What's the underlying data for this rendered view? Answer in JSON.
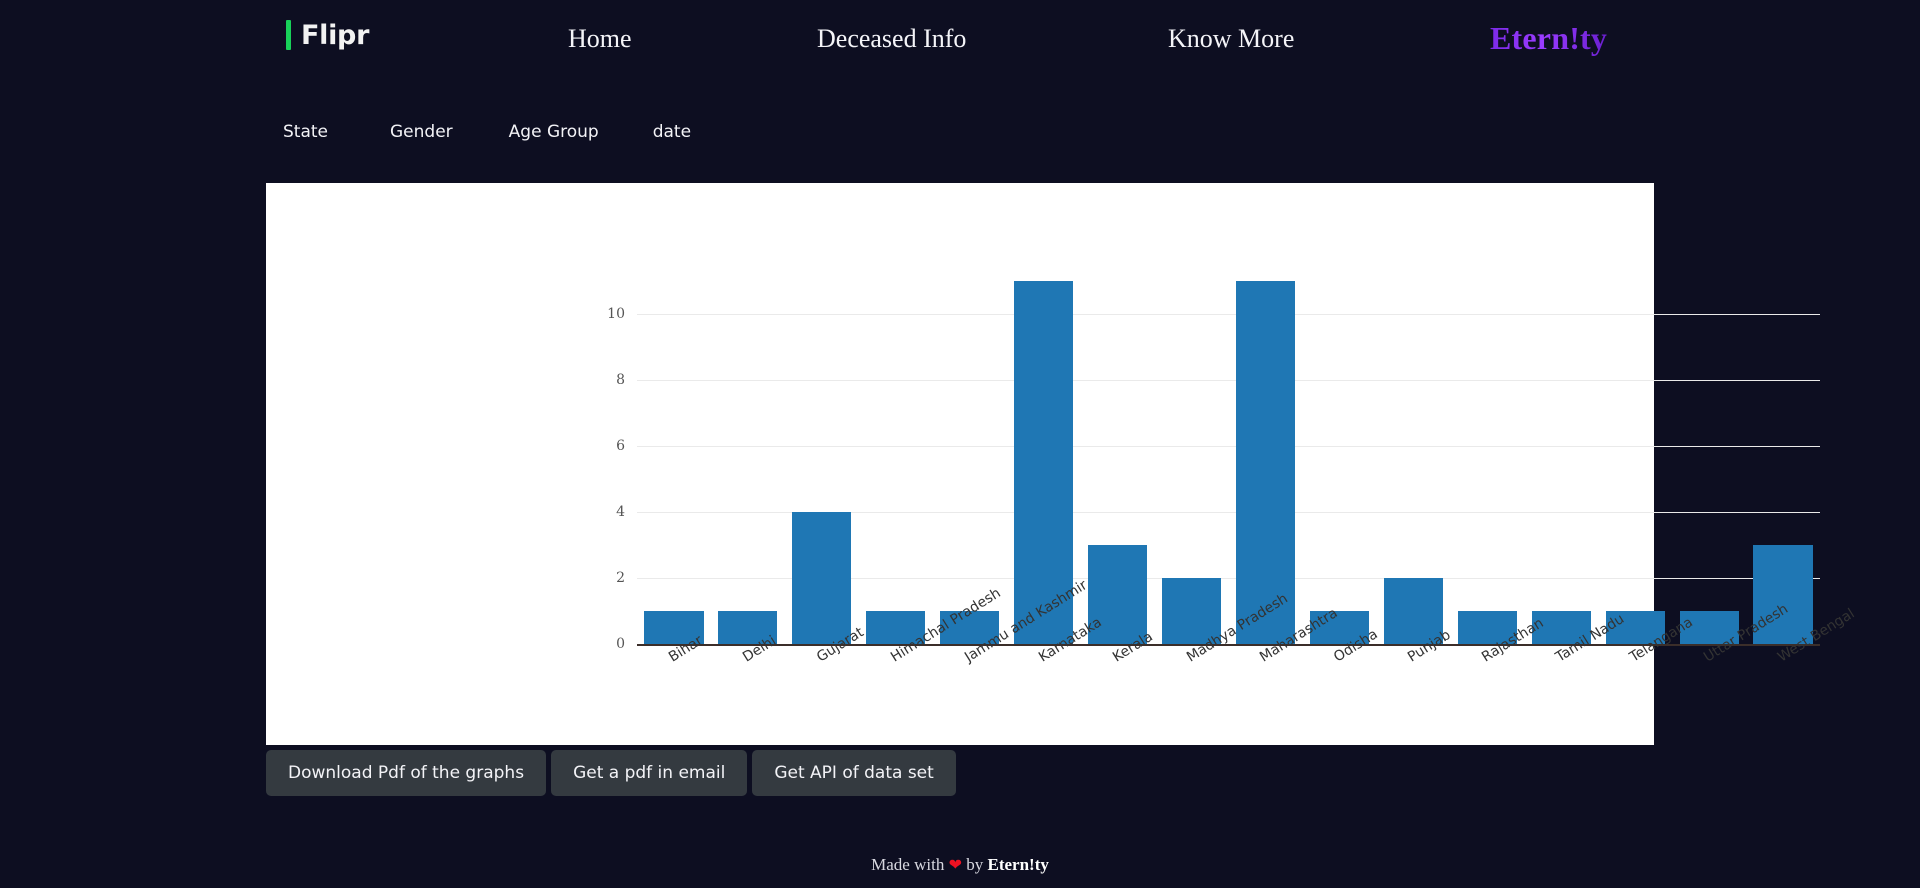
{
  "navbar": {
    "brand": "Flipr",
    "brand_bar_color": "#18d159",
    "links": [
      {
        "label": "Home",
        "name": "nav-link-home"
      },
      {
        "label": "Deceased Info",
        "name": "nav-link-deceased-info"
      },
      {
        "label": "Know More",
        "name": "nav-link-know-more"
      }
    ],
    "logo": "Etern!ty",
    "logo_color": "#8b2ff0"
  },
  "filters": [
    {
      "label": "State"
    },
    {
      "label": "Gender"
    },
    {
      "label": "Age Group"
    },
    {
      "label": "date"
    }
  ],
  "buttons": [
    {
      "label": "Download Pdf of the graphs"
    },
    {
      "label": "Get a pdf in email"
    },
    {
      "label": "Get API of data set"
    }
  ],
  "footer": {
    "prefix": "Made with",
    "heart": "❤",
    "middle": "by",
    "brand": "Etern!ty"
  },
  "theme": {
    "background": "#0d0e21",
    "panel": "#ffffff",
    "bar": "#1f77b4",
    "button": "#343a40",
    "axis": "#3b2e2a",
    "grid": "#eaeaea"
  },
  "chart_data": {
    "type": "bar",
    "title": "",
    "xlabel": "",
    "ylabel": "",
    "ylim": [
      0,
      12
    ],
    "yticks": [
      0,
      2,
      4,
      6,
      8,
      10
    ],
    "grid": true,
    "legend": "none",
    "xtick_rotation": -32,
    "categories": [
      "Bihar",
      "Delhi",
      "Gujarat",
      "Himachal Pradesh",
      "Jammu and Kashmir",
      "Karnataka",
      "Kerala",
      "Madhya Pradesh",
      "Maharashtra",
      "Odisha",
      "Punjab",
      "Rajasthan",
      "Tamil Nadu",
      "Telangana",
      "Uttar Pradesh",
      "West Bengal"
    ],
    "values": [
      1,
      1,
      4,
      1,
      1,
      11,
      3,
      2,
      11,
      1,
      2,
      1,
      1,
      1,
      1,
      3
    ]
  }
}
